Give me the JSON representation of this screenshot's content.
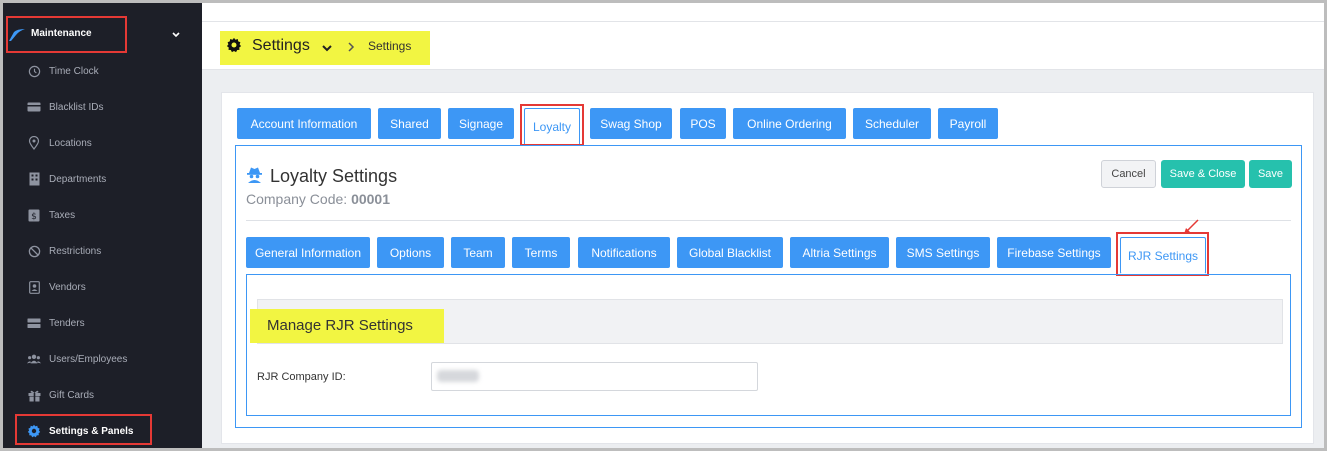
{
  "sidebar": {
    "title": "Maintenance",
    "items": [
      {
        "label": "Time Clock",
        "icon": "clock-icon"
      },
      {
        "label": "Blacklist IDs",
        "icon": "id-card-icon"
      },
      {
        "label": "Locations",
        "icon": "map-pin-icon"
      },
      {
        "label": "Departments",
        "icon": "building-icon"
      },
      {
        "label": "Taxes",
        "icon": "dollar-box-icon"
      },
      {
        "label": "Restrictions",
        "icon": "ban-icon"
      },
      {
        "label": "Vendors",
        "icon": "contact-card-icon"
      },
      {
        "label": "Tenders",
        "icon": "money-icon"
      },
      {
        "label": "Users/Employees",
        "icon": "users-icon"
      },
      {
        "label": "Gift Cards",
        "icon": "gift-icon"
      },
      {
        "label": "Settings & Panels",
        "icon": "gear-icon"
      }
    ]
  },
  "breadcrumb": {
    "title": "Settings",
    "current": "Settings"
  },
  "tabs": [
    {
      "label": "Account Information"
    },
    {
      "label": "Shared"
    },
    {
      "label": "Signage"
    },
    {
      "label": "Loyalty"
    },
    {
      "label": "Swag Shop"
    },
    {
      "label": "POS"
    },
    {
      "label": "Online Ordering"
    },
    {
      "label": "Scheduler"
    },
    {
      "label": "Payroll"
    }
  ],
  "loyalty": {
    "title": "Loyalty Settings",
    "company_code_label": "Company Code:",
    "company_code": "00001",
    "cancel_label": "Cancel",
    "save_close_label": "Save & Close",
    "save_label": "Save"
  },
  "subtabs": [
    {
      "label": "General Information"
    },
    {
      "label": "Options"
    },
    {
      "label": "Team"
    },
    {
      "label": "Terms"
    },
    {
      "label": "Notifications"
    },
    {
      "label": "Global Blacklist"
    },
    {
      "label": "Altria Settings"
    },
    {
      "label": "SMS Settings"
    },
    {
      "label": "Firebase Settings"
    },
    {
      "label": "RJR Settings"
    }
  ],
  "rjr": {
    "section_title": "Manage RJR Settings",
    "company_id_label": "RJR Company ID:"
  },
  "colors": {
    "primary": "#3d97f5",
    "success": "#26c1ad",
    "highlight": "#f2f542",
    "annotation": "#e53935",
    "sidebar_bg": "#1d1f28"
  }
}
